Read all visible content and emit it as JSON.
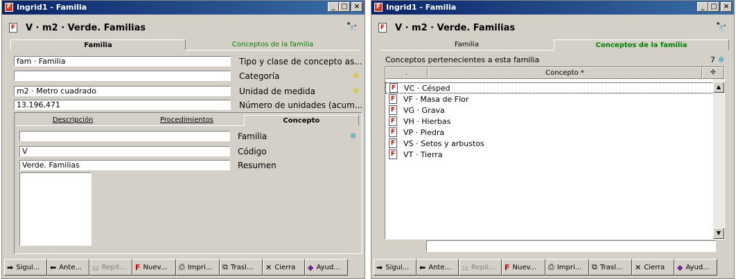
{
  "window1": {
    "title": "Ingrid1 - Familia",
    "header_title": "V · m2 · Verde. Familias",
    "tabs": [
      "Familia",
      "Conceptos de la familia"
    ],
    "fields": [
      {
        "value": "fam · Familia",
        "label": "Tipo y clase de concepto as..."
      },
      {
        "value": "",
        "label": "Categoría"
      },
      {
        "value": "m2 · Metro cuadrado",
        "label": "Unidad de medida"
      },
      {
        "value": "13.196,471",
        "label": "Número de unidades (acum..."
      }
    ],
    "subtabs": [
      "Descripción",
      "Procedimientos",
      "Concepto"
    ],
    "concept_fields": [
      {
        "value": "",
        "label": "Familia"
      },
      {
        "value": "V",
        "label": "Código"
      },
      {
        "value": "Verde. Familias",
        "label": "Resumen"
      }
    ],
    "toolbar": [
      "Sigui...",
      "Ante...",
      "Repit...",
      "Nuev...",
      "Impri...",
      "Trasl...",
      "Cierra",
      "Ayud..."
    ]
  },
  "window2": {
    "title": "Ingrid1 - Familia",
    "header_title": "V · m2 · Verde. Familias",
    "tabs": [
      "Familia",
      "Conceptos de la familia"
    ],
    "list_caption": "Conceptos pertenecientes a esta familia",
    "list_count": "7",
    "columns": [
      ".",
      "Concepto *"
    ],
    "rows": [
      "VC · Césped",
      "VF · Masa de Flor",
      "VG · Grava",
      "VH · Hierbas",
      "VP · Piedra",
      "VS · Setos y arbustos",
      "VT · Tierra"
    ],
    "search_value": "",
    "toolbar": [
      "Sigui...",
      "Ante...",
      "Repit...",
      "Nuev...",
      "Impri...",
      "Trasl...",
      "Cierra",
      "Ayud..."
    ]
  },
  "icons": {
    "next": "arrow-right-icon",
    "prev": "arrow-left-icon",
    "repeat": "repeat-icon",
    "new": "new-document-icon",
    "print": "printer-icon",
    "transfer": "transfer-icon",
    "close": "x-icon",
    "help": "help-book-icon",
    "search": "binoculars-icon"
  },
  "colors": {
    "titlebar": "#0a246a",
    "window_bg": "#d4d0c8",
    "tab_inactive_text": "#008000",
    "yellow_star": "#e0c000",
    "blue_star": "#29a0c0"
  }
}
